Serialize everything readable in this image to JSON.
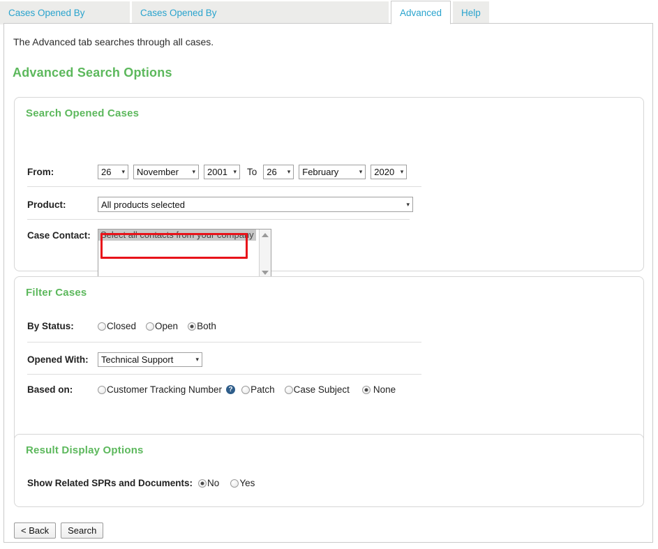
{
  "tabs": [
    {
      "label": "Cases Opened By",
      "active": false
    },
    {
      "label": "Cases Opened By",
      "active": false
    },
    {
      "label": "Advanced",
      "active": true
    },
    {
      "label": "Help",
      "active": false
    }
  ],
  "intro_text": "The Advanced tab searches through all cases.",
  "page_title": "Advanced Search Options",
  "panels": {
    "search": {
      "title": "Search Opened Cases",
      "from_label": "From:",
      "to_label": "To",
      "from_day": "26",
      "from_month": "November",
      "from_year": "2001",
      "to_day": "26",
      "to_month": "February",
      "to_year": "2020",
      "product_label": "Product:",
      "product_value": "All products selected",
      "case_contact_label": "Case Contact:",
      "case_contact_option": "Select all contacts from your company"
    },
    "filter": {
      "title": "Filter Cases",
      "status_label": "By Status:",
      "status_options": [
        {
          "label": "Closed",
          "checked": false
        },
        {
          "label": "Open",
          "checked": false
        },
        {
          "label": "Both",
          "checked": true
        }
      ],
      "opened_with_label": "Opened With:",
      "opened_with_value": "Technical Support",
      "based_on_label": "Based on:",
      "based_on_options": [
        {
          "label": "Customer Tracking Number",
          "checked": false,
          "help": true
        },
        {
          "label": "Patch",
          "checked": false,
          "help": false
        },
        {
          "label": "Case Subject",
          "checked": false,
          "help": false
        },
        {
          "label": "None",
          "checked": true,
          "help": false
        }
      ]
    },
    "result": {
      "title": "Result Display Options",
      "spr_label": "Show Related SPRs and Documents:",
      "spr_options": [
        {
          "label": "No",
          "checked": true
        },
        {
          "label": "Yes",
          "checked": false
        }
      ]
    }
  },
  "buttons": {
    "back": "< Back",
    "search": "Search"
  },
  "icons": {
    "caret": "▾",
    "help": "?"
  },
  "colors": {
    "accent_green": "#5cb85c",
    "tab_link_blue": "#29a3cd",
    "highlight_red": "#e8131a",
    "help_blue": "#2e5d8a"
  }
}
